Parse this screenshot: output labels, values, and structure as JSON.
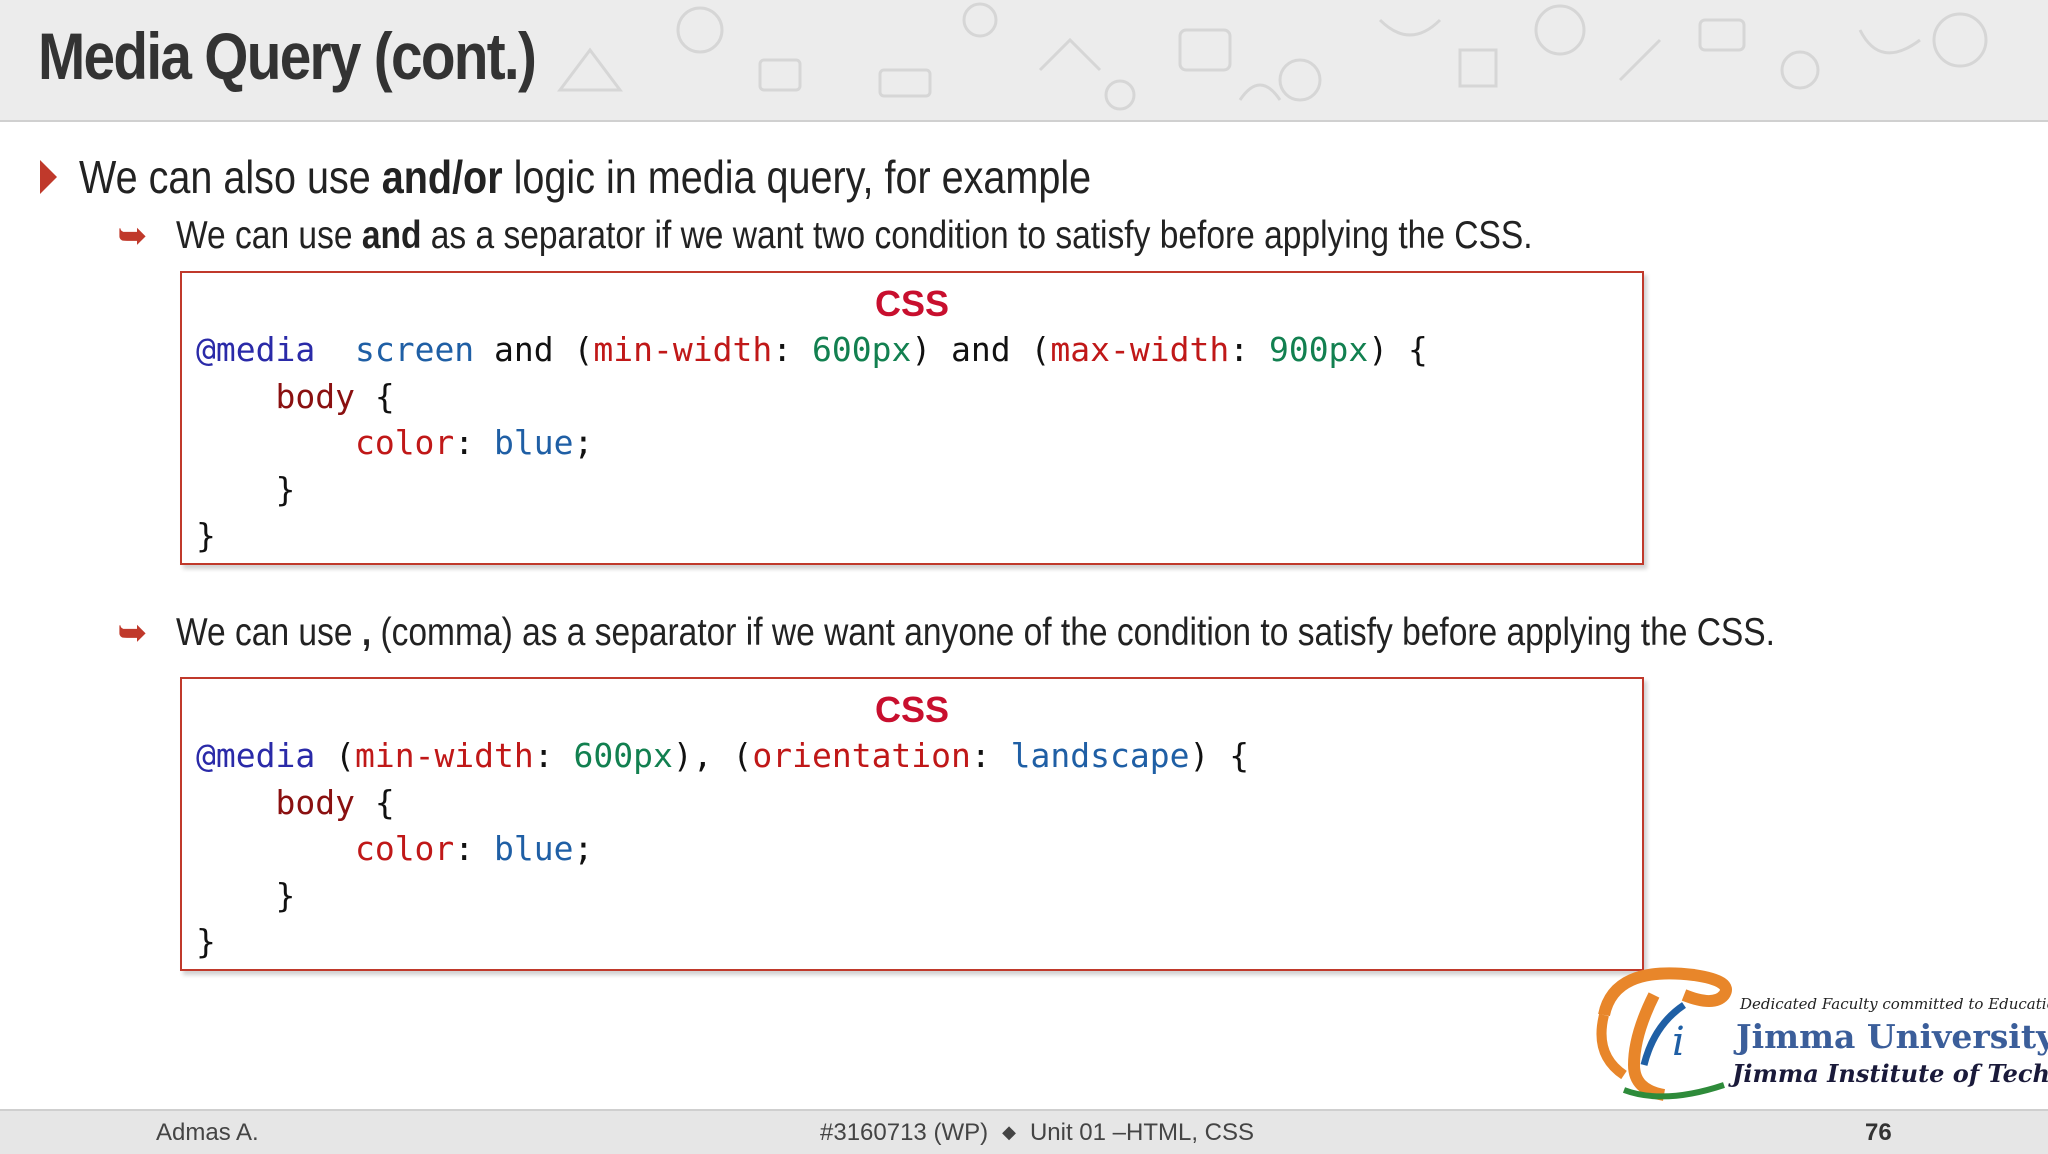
{
  "slide": {
    "title": "Media Query (cont.)",
    "bullet": {
      "pre": "We can also use ",
      "bold": "and/or",
      "post": " logic in media query, for example"
    },
    "sub1": {
      "pre": "We can use ",
      "bold": "and",
      "post": " as a separator if we want two condition to satisfy before applying the CSS."
    },
    "sub2": {
      "pre": "We can use ",
      "bold": ",",
      "post": " (comma) as a separator if we want anyone of the condition to satisfy before applying the CSS."
    },
    "code1": {
      "label": "CSS",
      "lines": [
        [
          [
            "kw",
            "@media"
          ],
          [
            "",
            "  "
          ],
          [
            "kw2",
            "screen"
          ],
          [
            "",
            " and ("
          ],
          [
            "prop",
            "min-width"
          ],
          [
            "",
            ": "
          ],
          [
            "num",
            "600px"
          ],
          [
            "",
            ") and ("
          ],
          [
            "prop",
            "max-width"
          ],
          [
            "",
            ": "
          ],
          [
            "num",
            "900px"
          ],
          [
            "",
            ") {"
          ]
        ],
        [
          [
            "",
            "    "
          ],
          [
            "sel",
            "body"
          ],
          [
            "",
            " {"
          ]
        ],
        [
          [
            "",
            "        "
          ],
          [
            "prop",
            "color"
          ],
          [
            "",
            ": "
          ],
          [
            "kw2",
            "blue"
          ],
          [
            "",
            ";"
          ]
        ],
        [
          [
            "",
            "    }"
          ]
        ],
        [
          [
            "",
            "}"
          ]
        ]
      ]
    },
    "code2": {
      "label": "CSS",
      "lines": [
        [
          [
            "kw",
            "@media"
          ],
          [
            "",
            " ("
          ],
          [
            "prop",
            "min-width"
          ],
          [
            "",
            ": "
          ],
          [
            "num",
            "600px"
          ],
          [
            "",
            "), ("
          ],
          [
            "prop",
            "orientation"
          ],
          [
            "",
            ": "
          ],
          [
            "kw2",
            "landscape"
          ],
          [
            "",
            ") {"
          ]
        ],
        [
          [
            "",
            "    "
          ],
          [
            "sel",
            "body"
          ],
          [
            "",
            " {"
          ]
        ],
        [
          [
            "",
            "        "
          ],
          [
            "prop",
            "color"
          ],
          [
            "",
            ": "
          ],
          [
            "kw2",
            "blue"
          ],
          [
            "",
            ";"
          ]
        ],
        [
          [
            "",
            "    }"
          ]
        ],
        [
          [
            "",
            "}"
          ]
        ]
      ]
    }
  },
  "footer": {
    "author": "Admas A.",
    "course": "#3160713 (WP)",
    "separator": "◆",
    "unit": "Unit 01 –HTML, CSS",
    "page": "76"
  },
  "logo": {
    "tagline": "Dedicated Faculty committed to Education",
    "name": "Jimma University",
    "institute": "Jimma Institute of Technology"
  },
  "colors": {
    "accent": "#c0392b",
    "code_label": "#c80f2e",
    "keyword": "#2a2aa8",
    "value": "#1f5fa5",
    "property": "#c01818",
    "number": "#128050"
  }
}
